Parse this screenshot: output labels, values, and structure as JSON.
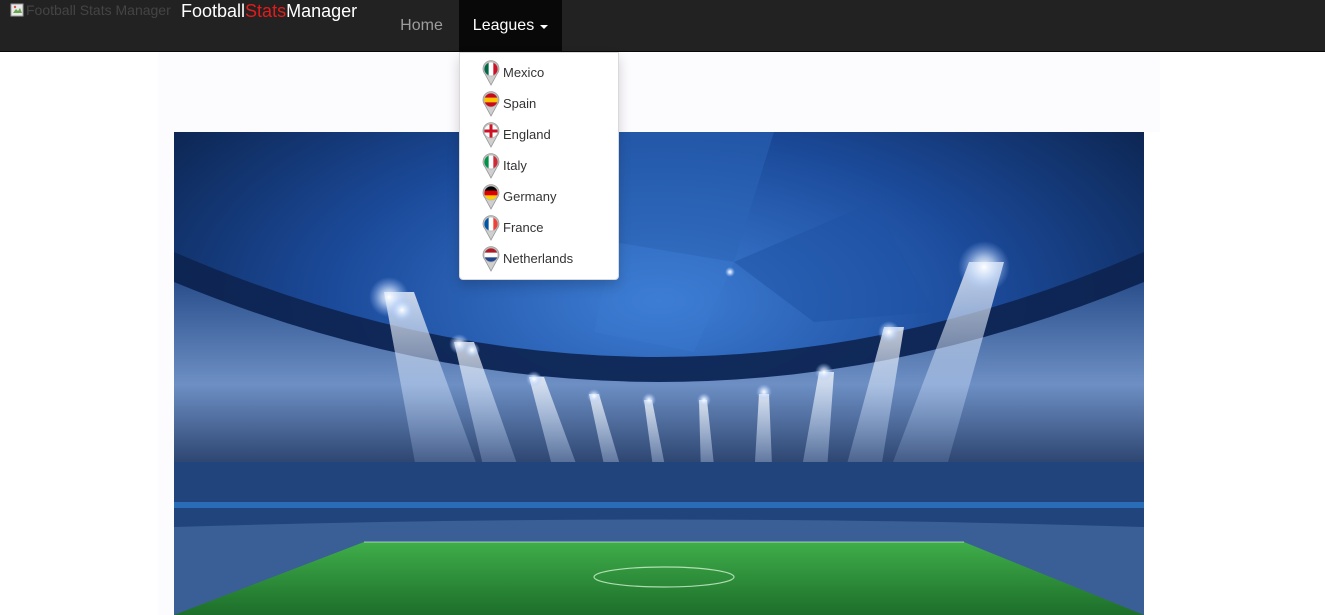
{
  "navbar": {
    "logo_alt": "Football Stats Manager",
    "brand_parts": [
      "Football",
      "Stats",
      "Manager"
    ],
    "home_label": "Home",
    "leagues_label": "Leagues"
  },
  "leagues_menu": {
    "items": [
      {
        "label": "Mexico",
        "flag": "mexico-flag-icon",
        "colors": [
          "#006847",
          "#ffffff",
          "#ce1126"
        ],
        "orientation": "vertical"
      },
      {
        "label": "Spain",
        "flag": "spain-flag-icon",
        "colors": [
          "#c60b1e",
          "#ffc400",
          "#c60b1e"
        ],
        "orientation": "horizontal"
      },
      {
        "label": "England",
        "flag": "england-flag-icon",
        "colors": [
          "#ffffff",
          "#ce1124"
        ],
        "orientation": "cross"
      },
      {
        "label": "Italy",
        "flag": "italy-flag-icon",
        "colors": [
          "#009246",
          "#ffffff",
          "#ce2b37"
        ],
        "orientation": "vertical"
      },
      {
        "label": "Germany",
        "flag": "germany-flag-icon",
        "colors": [
          "#000000",
          "#dd0000",
          "#ffce00"
        ],
        "orientation": "horizontal"
      },
      {
        "label": "France",
        "flag": "france-flag-icon",
        "colors": [
          "#0055a4",
          "#ffffff",
          "#ef4135"
        ],
        "orientation": "vertical"
      },
      {
        "label": "Netherlands",
        "flag": "netherlands-flag-icon",
        "colors": [
          "#ae1c28",
          "#ffffff",
          "#21468b"
        ],
        "orientation": "horizontal"
      }
    ]
  },
  "colors": {
    "navbar_bg": "#222222",
    "brand_accent": "#e21b1b",
    "active_bg": "#080808"
  }
}
